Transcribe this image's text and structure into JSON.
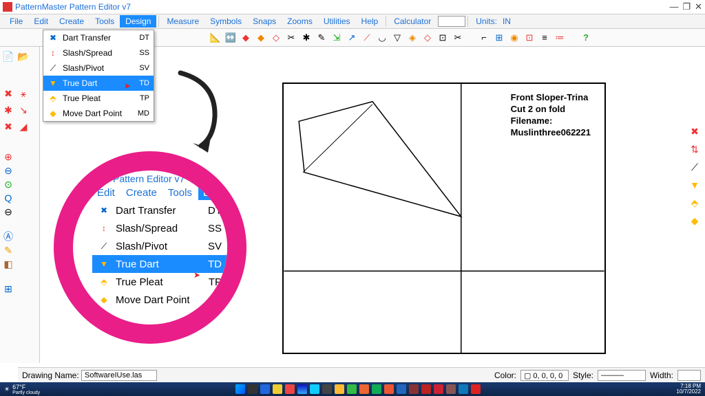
{
  "app": {
    "title": "PatternMaster Pattern Editor v7"
  },
  "menubar": {
    "file": "File",
    "edit": "Edit",
    "create": "Create",
    "tools": "Tools",
    "design": "Design",
    "measure": "Measure",
    "symbols": "Symbols",
    "snaps": "Snaps",
    "zooms": "Zooms",
    "utilities": "Utilities",
    "help": "Help",
    "calculator": "Calculator",
    "units_label": "Units:",
    "units_value": "IN"
  },
  "dropdown": {
    "items": [
      {
        "label": "Dart Transfer",
        "code": "DT"
      },
      {
        "label": "Slash/Spread",
        "code": "SS"
      },
      {
        "label": "Slash/Pivot",
        "code": "SV"
      },
      {
        "label": "True Dart",
        "code": "TD"
      },
      {
        "label": "True Pleat",
        "code": "TP"
      },
      {
        "label": "Move Dart Point",
        "code": "MD"
      }
    ]
  },
  "zoom": {
    "title": "Pattern Editor v7",
    "menus": {
      "edit": "Edit",
      "create": "Create",
      "tools": "Tools",
      "design": "Desi"
    }
  },
  "pattern_text": {
    "l1": "Front Sloper-Trina",
    "l2": "Cut 2 on fold",
    "l3": "Filename:",
    "l4": "Muslinthree062221"
  },
  "status": {
    "drawing_label": "Drawing Name:",
    "drawing_value": "SoftwareIUse.las",
    "color_label": "Color:",
    "color_value": "0, 0, 0, 0",
    "style_label": "Style:",
    "width_label": "Width:"
  },
  "taskbar": {
    "temp": "67°F",
    "cond": "Partly cloudy",
    "time": "7:18 PM",
    "date": "10/7/2022"
  }
}
